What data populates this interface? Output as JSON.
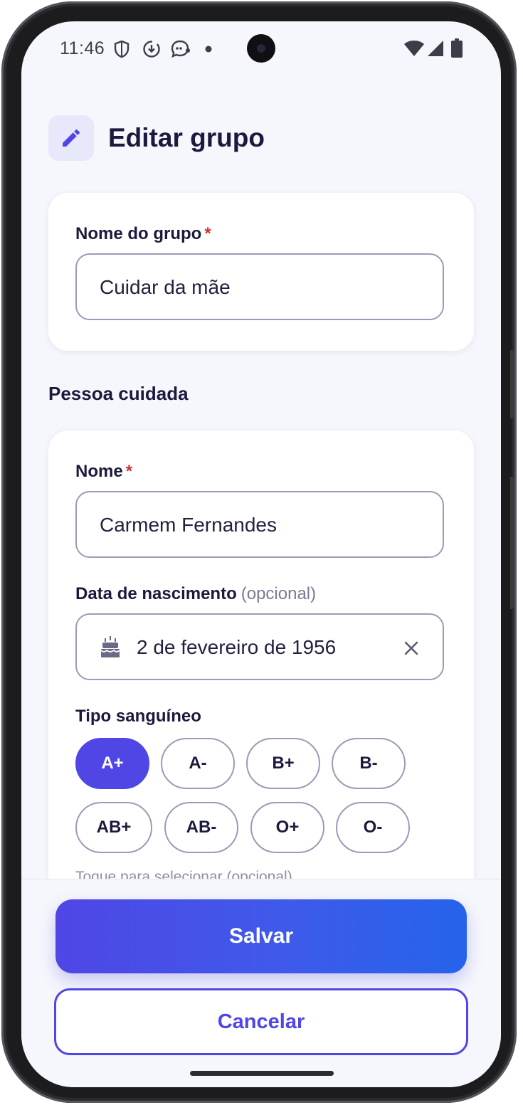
{
  "status_bar": {
    "time": "11:46",
    "left_icons": [
      "shield-icon",
      "download-icon",
      "chat-icon",
      "dot-icon"
    ],
    "right_icons": [
      "wifi-icon",
      "cellular-signal-icon",
      "battery-icon"
    ]
  },
  "header": {
    "icon": "pencil-icon",
    "title": "Editar grupo"
  },
  "group_card": {
    "label": "Nome do grupo",
    "required_mark": "*",
    "value": "Cuidar da mãe"
  },
  "section": {
    "title": "Pessoa cuidada"
  },
  "person_card": {
    "name_label": "Nome",
    "name_required_mark": "*",
    "name_value": "Carmem Fernandes",
    "birth_label": "Data de nascimento",
    "birth_optional": "(opcional)",
    "birth_icon": "cake-icon",
    "birth_value": "2 de fevereiro de 1956",
    "birth_clear_icon": "close-icon",
    "blood_label": "Tipo sanguíneo",
    "blood_types": [
      "A+",
      "A-",
      "B+",
      "B-",
      "AB+",
      "AB-",
      "O+",
      "O-"
    ],
    "blood_selected": "A+",
    "blood_hint": "Toque para selecionar (opcional)"
  },
  "actions": {
    "save_label": "Salvar",
    "cancel_label": "Cancelar"
  },
  "colors": {
    "accent": "#4f46e5",
    "accent_end": "#2563eb",
    "background": "#f6f7fc",
    "required": "#d32f2f"
  }
}
